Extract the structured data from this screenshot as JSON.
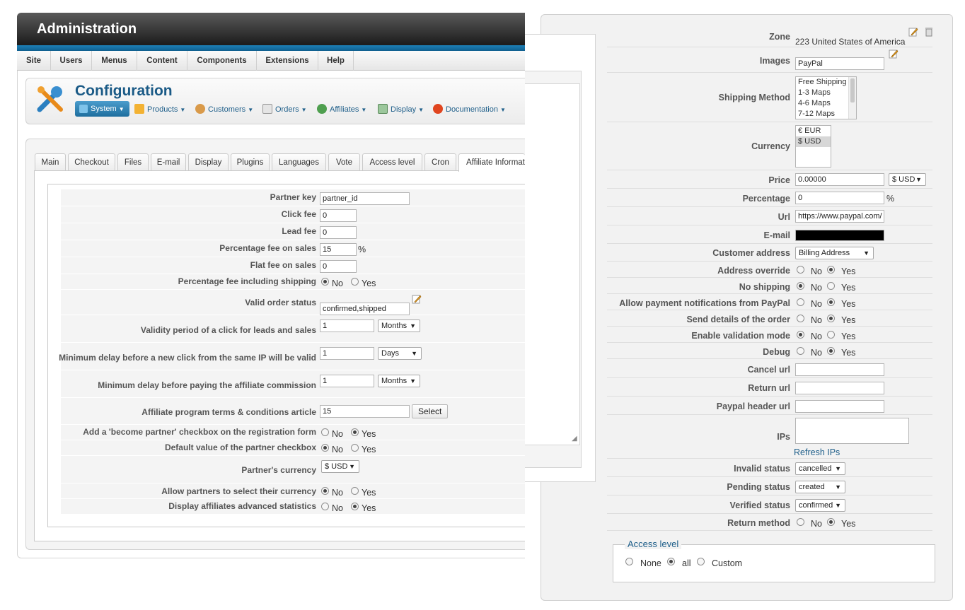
{
  "admin": {
    "title": "Administration",
    "menu": [
      "Site",
      "Users",
      "Menus",
      "Content",
      "Components",
      "Extensions",
      "Help"
    ],
    "config_title": "Configuration",
    "submenu": [
      "System",
      "Products",
      "Customers",
      "Orders",
      "Affiliates",
      "Display",
      "Documentation"
    ],
    "tabs": [
      "Main",
      "Checkout",
      "Files",
      "E-mail",
      "Display",
      "Plugins",
      "Languages",
      "Vote",
      "Access level",
      "Cron",
      "Affiliate Information"
    ],
    "form": {
      "partner_key": {
        "label": "Partner key",
        "value": "partner_id"
      },
      "click_fee": {
        "label": "Click fee",
        "value": "0"
      },
      "lead_fee": {
        "label": "Lead fee",
        "value": "0"
      },
      "percentage_fee": {
        "label": "Percentage fee on sales",
        "value": "15",
        "unit": "%"
      },
      "flat_fee": {
        "label": "Flat fee on sales",
        "value": "0"
      },
      "pct_incl_shipping": {
        "label": "Percentage fee including shipping",
        "no": "No",
        "yes": "Yes",
        "selected": "No"
      },
      "valid_order_status": {
        "label": "Valid order status",
        "value": "confirmed,shipped"
      },
      "validity_period": {
        "label": "Validity period of a click for leads and sales",
        "value": "1",
        "unit": "Months"
      },
      "min_delay_click": {
        "label": "Minimum delay before a new click from the same IP will be valid",
        "value": "1",
        "unit": "Days"
      },
      "min_delay_pay": {
        "label": "Minimum delay before paying the affiliate commission",
        "value": "1",
        "unit": "Months"
      },
      "terms_article": {
        "label": "Affiliate program terms & conditions article",
        "value": "15",
        "button": "Select"
      },
      "become_partner": {
        "label": "Add a 'become partner' checkbox on the registration form",
        "no": "No",
        "yes": "Yes",
        "selected": "Yes"
      },
      "default_partner_checkbox": {
        "label": "Default value of the partner checkbox",
        "no": "No",
        "yes": "Yes",
        "selected": "No"
      },
      "partner_currency": {
        "label": "Partner's currency",
        "value": "$ USD"
      },
      "allow_select_currency": {
        "label": "Allow partners to select their currency",
        "no": "No",
        "yes": "Yes",
        "selected": "No"
      },
      "advanced_stats": {
        "label": "Display affiliates advanced statistics",
        "no": "No",
        "yes": "Yes",
        "selected": "Yes"
      }
    }
  },
  "paypal": {
    "zone": {
      "label": "Zone",
      "value": "223 United States of America"
    },
    "images": {
      "label": "Images",
      "value": "PayPal"
    },
    "shipping_method": {
      "label": "Shipping Method",
      "options": [
        "Free Shipping",
        "1-3 Maps",
        "4-6 Maps",
        "7-12 Maps"
      ]
    },
    "currency": {
      "label": "Currency",
      "options": [
        "€ EUR",
        "$ USD"
      ],
      "selected": "$ USD"
    },
    "price": {
      "label": "Price",
      "value": "0.00000",
      "currency": "$ USD"
    },
    "percentage": {
      "label": "Percentage",
      "value": "0",
      "unit": "%"
    },
    "url": {
      "label": "Url",
      "value": "https://www.paypal.com/"
    },
    "email": {
      "label": "E-mail",
      "value": ""
    },
    "customer_address": {
      "label": "Customer address",
      "value": "Billing Address"
    },
    "address_override": {
      "label": "Address override",
      "no": "No",
      "yes": "Yes",
      "selected": "Yes"
    },
    "no_shipping": {
      "label": "No shipping",
      "no": "No",
      "yes": "Yes",
      "selected": "No"
    },
    "payment_notifications": {
      "label": "Allow payment notifications from PayPal",
      "no": "No",
      "yes": "Yes",
      "selected": "Yes"
    },
    "send_details": {
      "label": "Send details of the order",
      "no": "No",
      "yes": "Yes",
      "selected": "Yes"
    },
    "validation_mode": {
      "label": "Enable validation mode",
      "no": "No",
      "yes": "Yes",
      "selected": "No"
    },
    "debug": {
      "label": "Debug",
      "no": "No",
      "yes": "Yes",
      "selected": "Yes"
    },
    "cancel_url": {
      "label": "Cancel url",
      "value": ""
    },
    "return_url": {
      "label": "Return url",
      "value": ""
    },
    "header_url": {
      "label": "Paypal header url",
      "value": ""
    },
    "ips": {
      "label": "IPs",
      "value": "",
      "refresh": "Refresh IPs"
    },
    "invalid_status": {
      "label": "Invalid status",
      "value": "cancelled"
    },
    "pending_status": {
      "label": "Pending status",
      "value": "created"
    },
    "verified_status": {
      "label": "Verified status",
      "value": "confirmed"
    },
    "return_method": {
      "label": "Return method",
      "no": "No",
      "yes": "Yes",
      "selected": "Yes"
    },
    "access_level": {
      "legend": "Access level",
      "options": [
        "None",
        "all",
        "Custom"
      ],
      "selected": "all"
    }
  },
  "colors": {
    "accent_blue": "#1a5a86",
    "titlebar": "#1b1b1b",
    "bluebar": "#1d7fb6"
  },
  "icons": [
    "tools-icon",
    "pencil-edit-icon",
    "trash-icon",
    "chevron-down-icon"
  ]
}
